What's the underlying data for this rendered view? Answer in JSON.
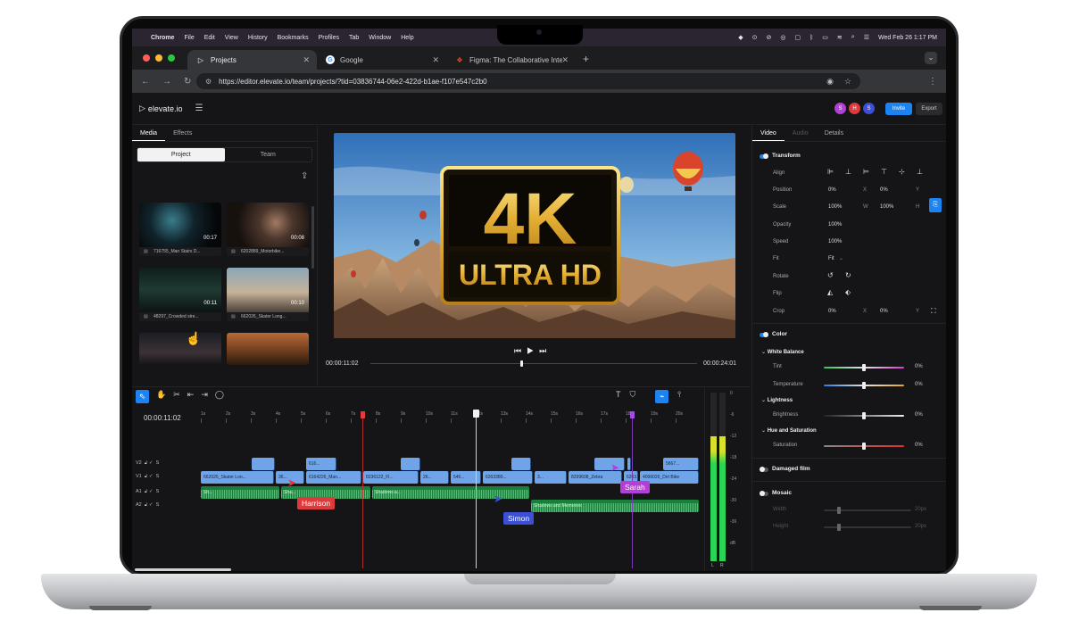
{
  "menubar": {
    "app": "Chrome",
    "items": [
      "File",
      "Edit",
      "View",
      "History",
      "Bookmarks",
      "Profiles",
      "Tab",
      "Window",
      "Help"
    ],
    "clock": "Wed Feb 26  1:17 PM"
  },
  "browser": {
    "tabs": [
      {
        "title": "Projects",
        "icon": "elevate-icon"
      },
      {
        "title": "Google",
        "icon": "google-icon"
      },
      {
        "title": "Figma: The Collaborative Inte",
        "icon": "figma-icon"
      }
    ],
    "url": "https://editor.elevate.io/team/projects/?tid=03836744-06e2-422d-b1ae-f107e547c2b0"
  },
  "app": {
    "logo": "elevate.io",
    "avatars": [
      {
        "letter": "S",
        "color": "#b23fd6"
      },
      {
        "letter": "H",
        "color": "#e0393b"
      },
      {
        "letter": "S",
        "color": "#3b4fd9"
      }
    ],
    "invite_label": "Invite",
    "export_label": "Export"
  },
  "media": {
    "tabs": [
      "Media",
      "Effects"
    ],
    "segments": [
      "Project",
      "Team"
    ],
    "thumbs": [
      {
        "duration": "00:17",
        "caption": "716755_Man Stairs D..."
      },
      {
        "duration": "00:08",
        "caption": "6202889_Motorbike..."
      },
      {
        "duration": "00:11",
        "caption": "48297_Crowded stre..."
      },
      {
        "duration": "00:10",
        "caption": "662026_Skater Long..."
      },
      {
        "duration": "",
        "caption": ""
      },
      {
        "duration": "",
        "caption": ""
      }
    ]
  },
  "preview": {
    "badge_top": "4K",
    "badge_bottom": "ULTRA HD",
    "time_current": "00:00:11:02",
    "time_total": "00:00:24:01",
    "progress": 0.46
  },
  "props": {
    "tabs": [
      "Video",
      "Audio",
      "Details"
    ],
    "transform": {
      "title": "Transform",
      "align_label": "Align",
      "position": {
        "label": "Position",
        "x": "0%",
        "x_unit": "X",
        "y": "0%",
        "y_unit": "Y"
      },
      "scale": {
        "label": "Scale",
        "w": "100%",
        "w_unit": "W",
        "h": "100%",
        "h_unit": "H"
      },
      "opacity": {
        "label": "Opacity",
        "value": "100%"
      },
      "speed": {
        "label": "Speed",
        "value": "100%"
      },
      "fit": {
        "label": "Fit",
        "value": "Fit"
      },
      "rotate_label": "Rotate",
      "flip_label": "Flip",
      "crop": {
        "label": "Crop",
        "x": "0%",
        "x_unit": "X",
        "y": "0%",
        "y_unit": "Y"
      }
    },
    "color": {
      "title": "Color",
      "white_balance": "White Balance",
      "tint": {
        "label": "Tint",
        "value": "0%"
      },
      "temperature": {
        "label": "Temperature",
        "value": "0%"
      },
      "lightness": "Lightness",
      "brightness": {
        "label": "Brightness",
        "value": "0%"
      },
      "hue_sat": "Hue and Saturation",
      "saturation": {
        "label": "Saturation",
        "value": "0%"
      }
    },
    "damaged_film": "Damaged film",
    "mosaic": {
      "title": "Mosaic",
      "width": {
        "label": "Width",
        "value": "20px"
      },
      "height": {
        "label": "Height",
        "value": "20px"
      }
    }
  },
  "timeline": {
    "current_time": "00:00:11:02",
    "ticks": [
      "1s",
      "2s",
      "3s",
      "4s",
      "5s",
      "6s",
      "7s",
      "8s",
      "9s",
      "10s",
      "11s",
      "12s",
      "13s",
      "14s",
      "15s",
      "16s",
      "17s",
      "18s",
      "19s",
      "20s"
    ],
    "tracks": [
      {
        "name": "V2",
        "flags": "S"
      },
      {
        "name": "V1",
        "flags": "S"
      },
      {
        "name": "A1",
        "flags": "S"
      },
      {
        "name": "A2",
        "flags": "S"
      }
    ],
    "v2_clips": [
      "",
      "616...",
      "",
      "",
      "",
      "",
      "5667..."
    ],
    "v1_clips": [
      "662026_Skater Lon...",
      "36...",
      "6164226_Man...",
      "8236122_Fl...",
      "26...",
      "546...",
      "6263380...",
      "3...",
      "8299608_Zebra",
      "6203...",
      "4096026_Dirt Bike"
    ],
    "a1_clips": [
      "Sh...",
      "Sha...",
      "Shadows a..."
    ],
    "a2_clips": [
      "Shadows and Memories"
    ],
    "meter_scale": [
      "0",
      "-6",
      "-12",
      "-18",
      "-24",
      "-30",
      "-36",
      "dB"
    ],
    "meter_lr": [
      "L",
      "R"
    ]
  },
  "cursors": [
    {
      "name": "Harrison",
      "color": "#e0393b"
    },
    {
      "name": "Simon",
      "color": "#3b4fd9"
    },
    {
      "name": "Sarah",
      "color": "#b23fd6"
    }
  ]
}
